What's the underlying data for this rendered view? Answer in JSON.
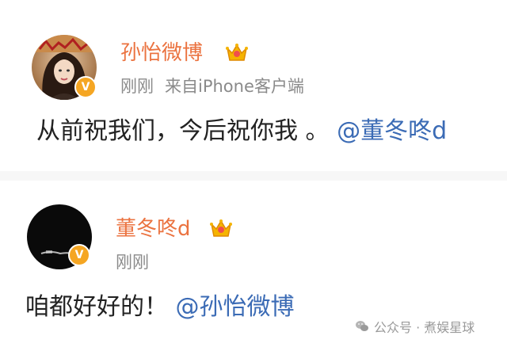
{
  "post1": {
    "username": "孙怡微博",
    "time": "刚刚",
    "source": "来自iPhone客户端",
    "text": "从前祝我们，今后祝你我 。",
    "mention": "@董冬咚d",
    "verified_badge": "V"
  },
  "post2": {
    "username": "董冬咚d",
    "time": "刚刚",
    "text": "咱都好好的！",
    "mention": "@孙怡微博",
    "verified_badge": "V"
  },
  "watermark": {
    "text": "公众号 · 煮娱星球"
  },
  "colors": {
    "username": "#eb7340",
    "mention": "#3b6bb5",
    "meta": "#8a8a8a",
    "badge": "#f5a623"
  }
}
